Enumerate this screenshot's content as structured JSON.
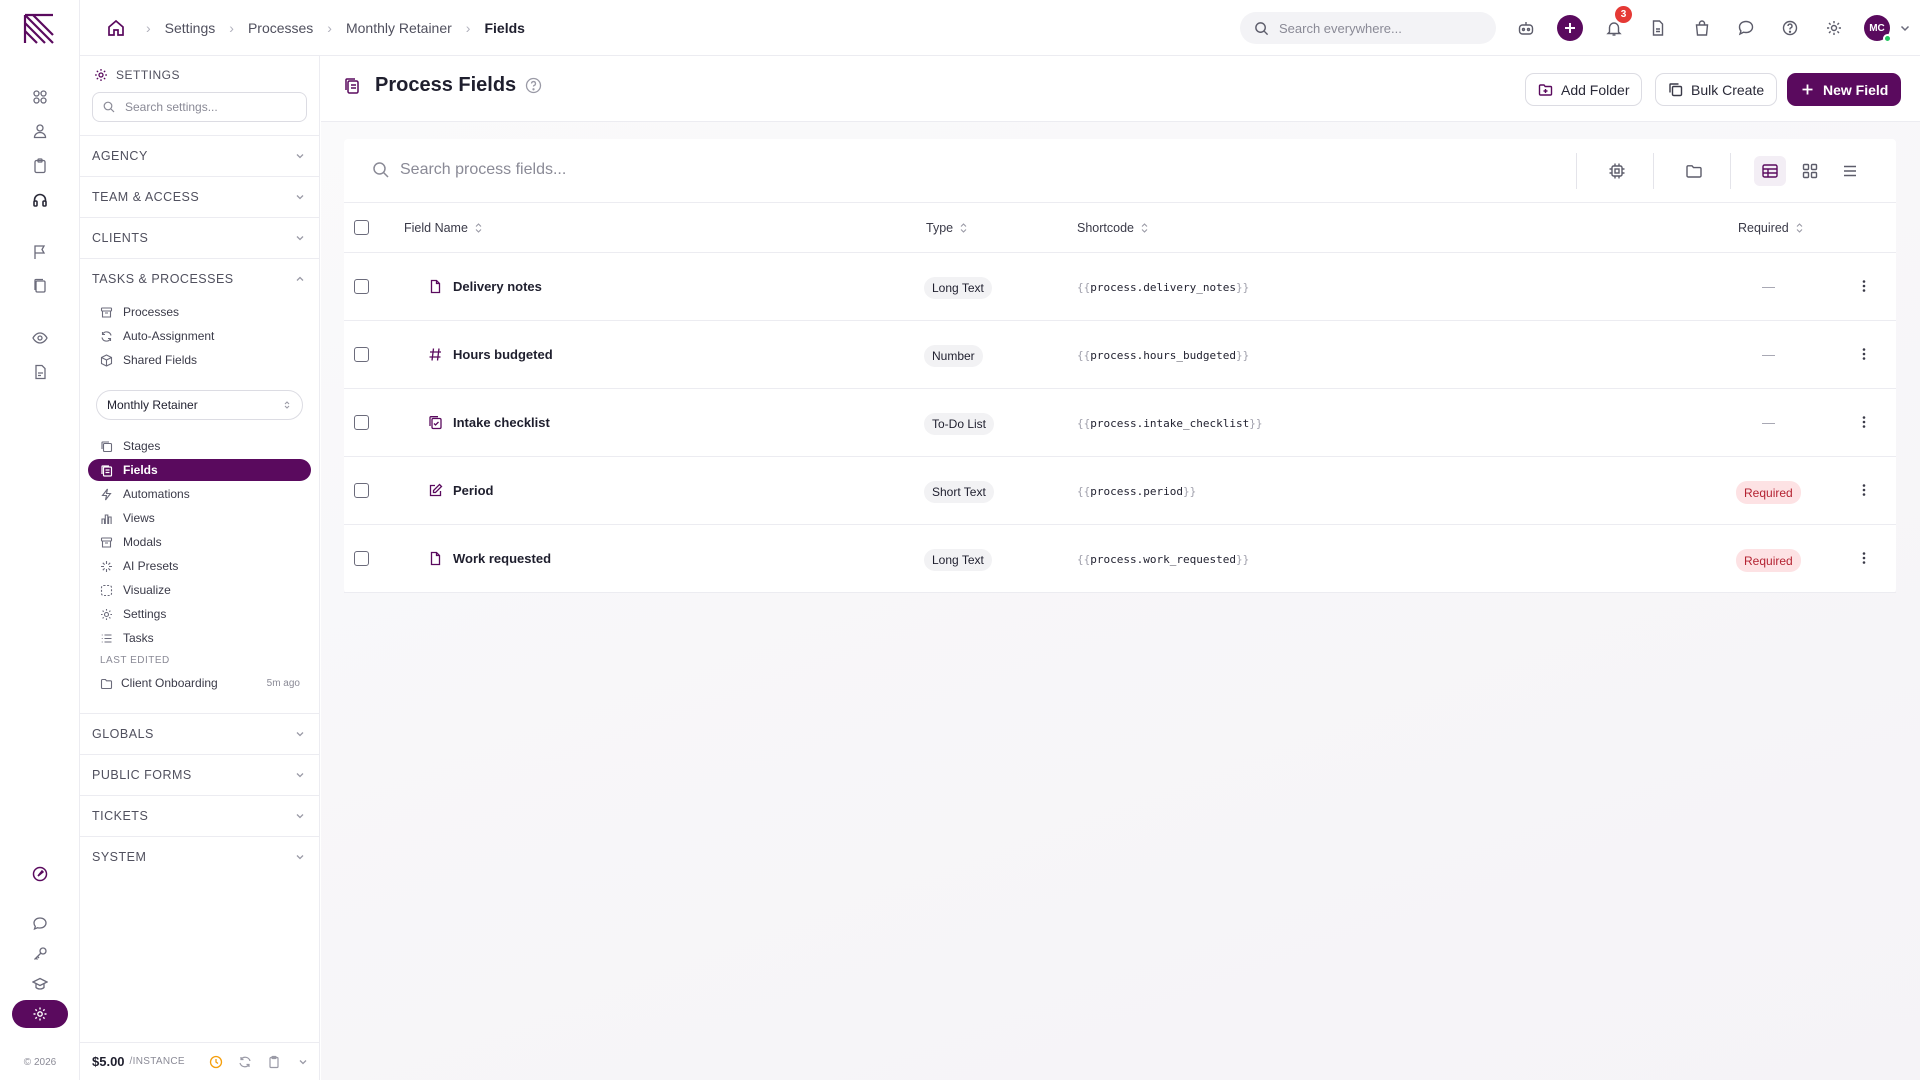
{
  "breadcrumb": {
    "items": [
      "Settings",
      "Processes",
      "Monthly Retainer"
    ],
    "current": "Fields"
  },
  "global_search": {
    "placeholder": "Search everywhere..."
  },
  "notifications": {
    "count": "3"
  },
  "user": {
    "initials": "MC"
  },
  "sidebar": {
    "header": "SETTINGS",
    "search_placeholder": "Search settings...",
    "sections": {
      "agency": "AGENCY",
      "team": "TEAM & ACCESS",
      "clients": "CLIENTS",
      "tasks": "TASKS & PROCESSES",
      "globals": "GLOBALS",
      "public_forms": "PUBLIC FORMS",
      "tickets": "TICKETS",
      "system": "SYSTEM"
    },
    "task_items": [
      {
        "label": "Processes",
        "icon": "archive-icon"
      },
      {
        "label": "Auto-Assignment",
        "icon": "refresh-icon"
      },
      {
        "label": "Shared Fields",
        "icon": "cube-icon"
      }
    ],
    "process_select": "Monthly Retainer",
    "process_items": [
      {
        "label": "Stages",
        "icon": "copy-icon"
      },
      {
        "label": "Fields",
        "icon": "fields-icon",
        "active": true
      },
      {
        "label": "Automations",
        "icon": "bolt-icon"
      },
      {
        "label": "Views",
        "icon": "bar-chart-icon"
      },
      {
        "label": "Modals",
        "icon": "archive-icon"
      },
      {
        "label": "AI Presets",
        "icon": "sparkle-icon"
      },
      {
        "label": "Visualize",
        "icon": "dashed-box-icon"
      },
      {
        "label": "Settings",
        "icon": "gear-icon"
      },
      {
        "label": "Tasks",
        "icon": "list-icon"
      }
    ],
    "last_edited": {
      "label": "LAST EDITED",
      "name": "Client Onboarding",
      "ago": "5m ago"
    },
    "footer": {
      "price": "$5.00",
      "per": "/INSTANCE"
    }
  },
  "rail": {
    "copyright": "© 2026"
  },
  "page": {
    "title": "Process Fields",
    "add_folder": "Add Folder",
    "bulk_create": "Bulk Create",
    "new_field": "New Field"
  },
  "table": {
    "search_placeholder": "Search process fields...",
    "columns": {
      "name": "Field Name",
      "type": "Type",
      "shortcode": "Shortcode",
      "required": "Required"
    },
    "rows": [
      {
        "name": "Delivery notes",
        "icon": "document-icon",
        "type": "Long Text",
        "shortcode": "process.delivery_notes",
        "required": false
      },
      {
        "name": "Hours budgeted",
        "icon": "hash-icon",
        "type": "Number",
        "shortcode": "process.hours_budgeted",
        "required": false
      },
      {
        "name": "Intake checklist",
        "icon": "checklist-icon",
        "type": "To-Do List",
        "shortcode": "process.intake_checklist",
        "required": false
      },
      {
        "name": "Period",
        "icon": "edit-icon",
        "type": "Short Text",
        "shortcode": "process.period",
        "required": true
      },
      {
        "name": "Work requested",
        "icon": "document-icon",
        "type": "Long Text",
        "shortcode": "process.work_requested",
        "required": true
      }
    ],
    "required_label": "Required",
    "brace_open": "{{",
    "brace_close": "}}"
  },
  "colors": {
    "brand": "#5a0a5e",
    "required_bg": "#fde2e4",
    "required_text": "#b42332",
    "badge": "#e53935"
  }
}
